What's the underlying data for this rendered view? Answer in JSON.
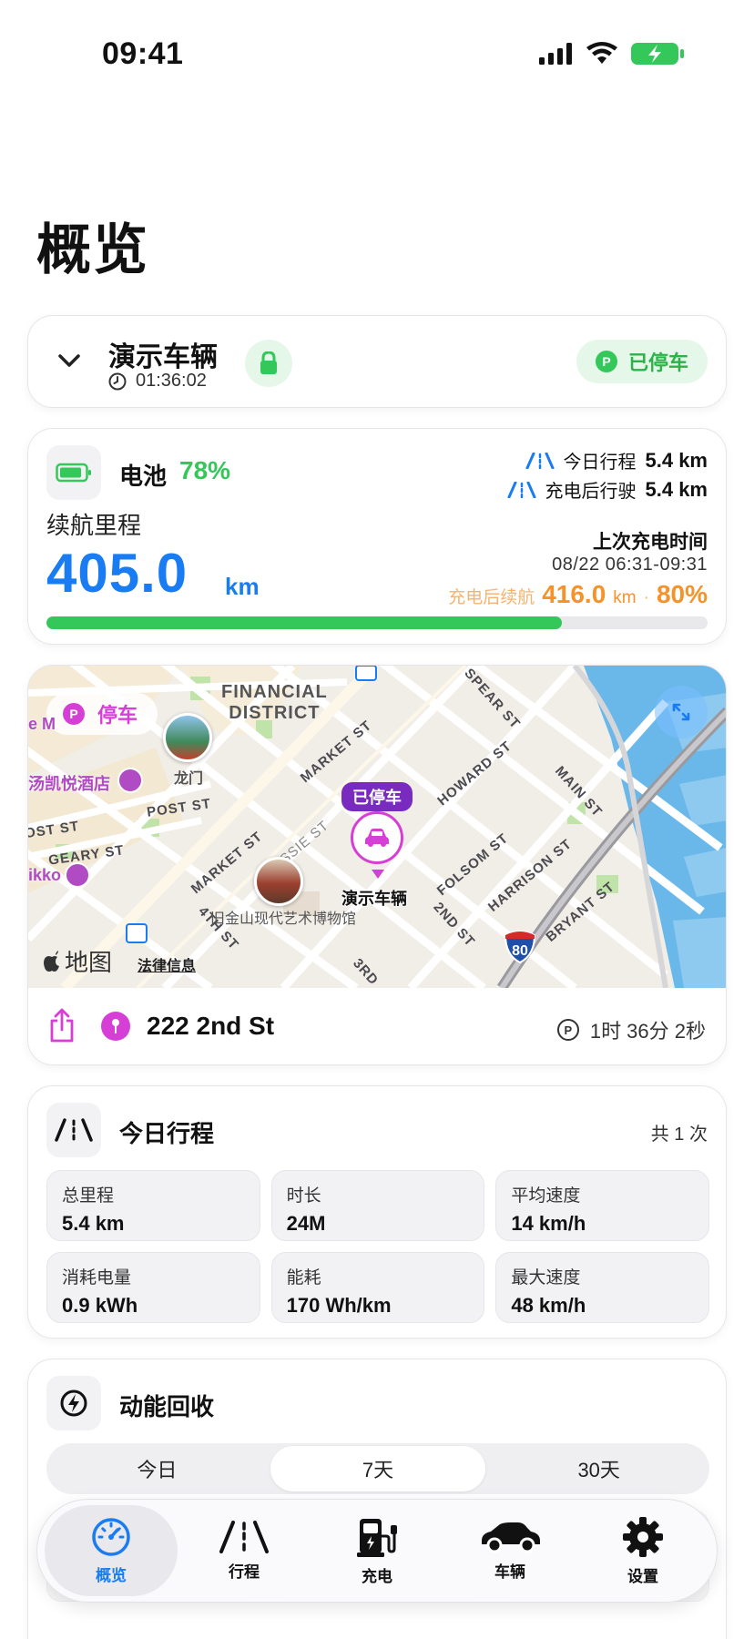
{
  "status": {
    "time": "09:41"
  },
  "page": {
    "title": "概览"
  },
  "vehicle": {
    "name": "演示车辆",
    "timer": "01:36:02",
    "state": "已停车",
    "state_p": "P"
  },
  "battery": {
    "label": "电池",
    "percent_text": "78%",
    "percent": 78,
    "range_label": "续航里程",
    "range_value": "405.0",
    "range_unit": "km",
    "today_label": "今日行程",
    "today_value": "5.4 km",
    "since_charge_label": "充电后行驶",
    "since_charge_value": "5.4 km",
    "last_charge_label": "上次充电时间",
    "last_charge_time": "08/22 06:31-09:31",
    "after_charge_label": "充电后续航",
    "after_charge_value": "416.0",
    "after_charge_unit": "km",
    "after_charge_sep": "·",
    "after_charge_pct": "80%",
    "colors": {
      "green": "#34c759",
      "blue": "#1a7cf2",
      "orange": "#f5922a"
    }
  },
  "map": {
    "parked_pill": "停车",
    "p": "P",
    "district": "FINANCIAL\nDISTRICT",
    "streets": {
      "market1": "MARKET ST",
      "market2": "MARKET ST",
      "spear": "SPEAR ST",
      "howard": "HOWARD ST",
      "main": "MAIN ST",
      "post": "POST ST",
      "ost": "OST ST",
      "geary": "GEARY ST",
      "jessie": "JESSIE ST",
      "folsom": "FOLSOM ST",
      "harrison": "HARRISON ST",
      "bryant": "BRYANT ST",
      "fourth": "4TH ST",
      "second": "2ND ST",
      "third": "3RD"
    },
    "poi_dragon_gate": "龙门",
    "hotel_1": "汤凯悦酒店",
    "hotel_1_prefix": "e M",
    "hotel_2": "ikko",
    "museum": "旧金山现代艺术博物馆",
    "car_tag": "已停车",
    "car_label": "演示车辆",
    "maps_logo": "地图",
    "legal": "法律信息",
    "highway": "80",
    "bart": "b"
  },
  "location": {
    "address": "222 2nd St",
    "park_duration": "1时 36分 2秒",
    "p": "P"
  },
  "trips": {
    "title": "今日行程",
    "count": "共 1 次",
    "stats": [
      {
        "k": "总里程",
        "v": "5.4 km"
      },
      {
        "k": "时长",
        "v": "24M"
      },
      {
        "k": "平均速度",
        "v": "14 km/h"
      },
      {
        "k": "消耗电量",
        "v": "0.9 kWh"
      },
      {
        "k": "能耗",
        "v": "170 Wh/km"
      },
      {
        "k": "最大速度",
        "v": "48 km/h"
      }
    ]
  },
  "regen": {
    "title": "动能回收",
    "segments": [
      "今日",
      "7天",
      "30天"
    ],
    "active_segment": 1
  },
  "tabs": [
    {
      "label": "概览",
      "icon": "speedometer-icon",
      "active": true
    },
    {
      "label": "行程",
      "icon": "road-icon",
      "active": false
    },
    {
      "label": "充电",
      "icon": "fuel-pump-icon",
      "active": false
    },
    {
      "label": "车辆",
      "icon": "car-icon",
      "active": false
    },
    {
      "label": "设置",
      "icon": "gear-icon",
      "active": false
    }
  ]
}
